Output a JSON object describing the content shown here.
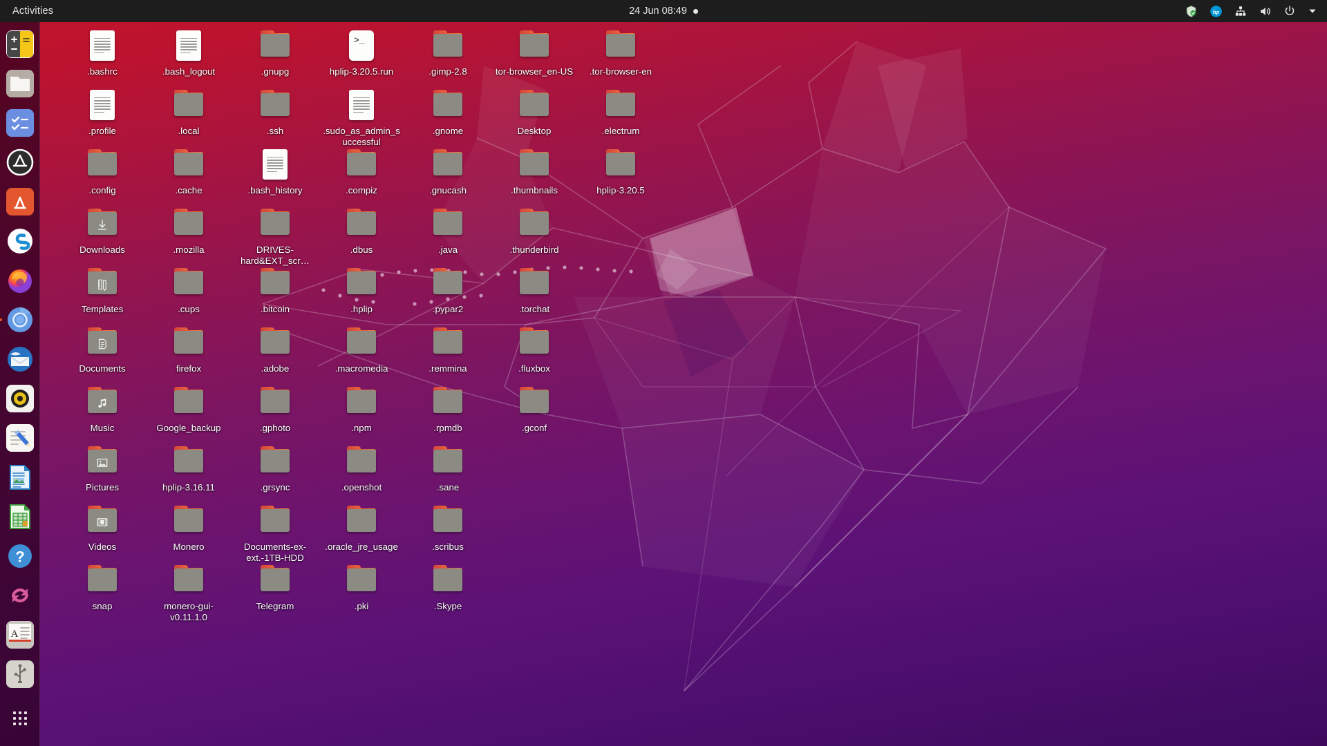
{
  "topbar": {
    "activities_label": "Activities",
    "clock": "24 Jun  08:49",
    "notification_dot": true,
    "indicators": [
      {
        "name": "shield-icon",
        "title": "Privacy Shield"
      },
      {
        "name": "hp-logo-icon",
        "title": "HP"
      },
      {
        "name": "network-icon",
        "title": "Wired Network"
      },
      {
        "name": "volume-icon",
        "title": "Volume"
      },
      {
        "name": "power-icon",
        "title": "Power"
      },
      {
        "name": "chevron-down-icon",
        "title": "System Menu"
      }
    ]
  },
  "dock": {
    "items": [
      {
        "name": "calculator",
        "label": "Calculator",
        "running": false
      },
      {
        "name": "files",
        "label": "Files",
        "running": false
      },
      {
        "name": "todo",
        "label": "To Do",
        "running": false
      },
      {
        "name": "ubuntu-software-updates",
        "label": "Software Updater",
        "running": false
      },
      {
        "name": "ubuntu-software",
        "label": "Ubuntu Software",
        "running": false
      },
      {
        "name": "skype",
        "label": "Skype",
        "running": false
      },
      {
        "name": "firefox",
        "label": "Firefox",
        "running": false
      },
      {
        "name": "chromium",
        "label": "Chromium",
        "running": true
      },
      {
        "name": "thunderbird",
        "label": "Thunderbird Mail",
        "running": false
      },
      {
        "name": "rhythmbox",
        "label": "Rhythmbox",
        "running": false
      },
      {
        "name": "text-editor",
        "label": "Text Editor",
        "running": false
      },
      {
        "name": "libreoffice-writer",
        "label": "LibreOffice Writer",
        "running": false
      },
      {
        "name": "libreoffice-calc",
        "label": "LibreOffice Calc",
        "running": false
      },
      {
        "name": "help",
        "label": "Help",
        "running": false
      },
      {
        "name": "software-updater-sync",
        "label": "Software Updater",
        "running": false
      },
      {
        "name": "dictionary",
        "label": "Dictionary",
        "running": false
      },
      {
        "name": "usb-creator",
        "label": "Startup Disk Creator",
        "running": false
      }
    ],
    "show_applications_label": "Show Applications"
  },
  "desktop": {
    "icons": [
      {
        "label": ".bashrc",
        "type": "file",
        "col": 0,
        "row": 0
      },
      {
        "label": ".bash_logout",
        "type": "file",
        "col": 1,
        "row": 0
      },
      {
        "label": ".gnupg",
        "type": "folder",
        "col": 2,
        "row": 0
      },
      {
        "label": "hplip-3.20.5.run",
        "type": "script",
        "col": 3,
        "row": 0
      },
      {
        "label": ".gimp-2.8",
        "type": "folder",
        "col": 4,
        "row": 0
      },
      {
        "label": "tor-browser_en-US",
        "type": "folder",
        "col": 5,
        "row": 0
      },
      {
        "label": ".tor-browser-en",
        "type": "folder",
        "col": 6,
        "row": 0
      },
      {
        "label": ".profile",
        "type": "file",
        "col": 0,
        "row": 1
      },
      {
        "label": ".local",
        "type": "folder",
        "col": 1,
        "row": 1
      },
      {
        "label": ".ssh",
        "type": "folder",
        "col": 2,
        "row": 1
      },
      {
        "label": ".sudo_as_admin_successful",
        "type": "file",
        "col": 3,
        "row": 1
      },
      {
        "label": ".gnome",
        "type": "folder",
        "col": 4,
        "row": 1
      },
      {
        "label": "Desktop",
        "type": "folder",
        "col": 5,
        "row": 1
      },
      {
        "label": ".electrum",
        "type": "folder",
        "col": 6,
        "row": 1
      },
      {
        "label": ".config",
        "type": "folder",
        "col": 0,
        "row": 2
      },
      {
        "label": ".cache",
        "type": "folder",
        "col": 1,
        "row": 2
      },
      {
        "label": ".bash_history",
        "type": "file",
        "col": 2,
        "row": 2
      },
      {
        "label": ".compiz",
        "type": "folder",
        "col": 3,
        "row": 2
      },
      {
        "label": ".gnucash",
        "type": "folder",
        "col": 4,
        "row": 2
      },
      {
        "label": ".thumbnails",
        "type": "folder",
        "col": 5,
        "row": 2
      },
      {
        "label": "hplip-3.20.5",
        "type": "folder",
        "col": 6,
        "row": 2
      },
      {
        "label": "Downloads",
        "type": "folder",
        "emblem": "download",
        "col": 0,
        "row": 3
      },
      {
        "label": ".mozilla",
        "type": "folder",
        "col": 1,
        "row": 3
      },
      {
        "label": "DRIVES-hard&EXT_scr…",
        "type": "folder",
        "col": 2,
        "row": 3
      },
      {
        "label": ".dbus",
        "type": "folder",
        "col": 3,
        "row": 3
      },
      {
        "label": ".java",
        "type": "folder",
        "col": 4,
        "row": 3
      },
      {
        "label": ".thunderbird",
        "type": "folder",
        "col": 5,
        "row": 3
      },
      {
        "label": "Templates",
        "type": "folder",
        "emblem": "template",
        "col": 0,
        "row": 4
      },
      {
        "label": ".cups",
        "type": "folder",
        "col": 1,
        "row": 4
      },
      {
        "label": ".bitcoin",
        "type": "folder",
        "col": 2,
        "row": 4
      },
      {
        "label": ".hplip",
        "type": "folder",
        "col": 3,
        "row": 4
      },
      {
        "label": ".pypar2",
        "type": "folder",
        "col": 4,
        "row": 4
      },
      {
        "label": ".torchat",
        "type": "folder",
        "col": 5,
        "row": 4
      },
      {
        "label": "Documents",
        "type": "folder",
        "emblem": "document",
        "col": 0,
        "row": 5
      },
      {
        "label": "firefox",
        "type": "folder",
        "col": 1,
        "row": 5
      },
      {
        "label": ".adobe",
        "type": "folder",
        "col": 2,
        "row": 5
      },
      {
        "label": ".macromedia",
        "type": "folder",
        "col": 3,
        "row": 5
      },
      {
        "label": ".remmina",
        "type": "folder",
        "col": 4,
        "row": 5
      },
      {
        "label": ".fluxbox",
        "type": "folder",
        "col": 5,
        "row": 5
      },
      {
        "label": "Music",
        "type": "folder",
        "emblem": "music",
        "col": 0,
        "row": 6
      },
      {
        "label": "Google_backup",
        "type": "folder",
        "col": 1,
        "row": 6
      },
      {
        "label": ".gphoto",
        "type": "folder",
        "col": 2,
        "row": 6
      },
      {
        "label": ".npm",
        "type": "folder",
        "col": 3,
        "row": 6
      },
      {
        "label": ".rpmdb",
        "type": "folder",
        "col": 4,
        "row": 6
      },
      {
        "label": ".gconf",
        "type": "folder",
        "col": 5,
        "row": 6
      },
      {
        "label": "Pictures",
        "type": "folder",
        "emblem": "picture",
        "col": 0,
        "row": 7
      },
      {
        "label": "hplip-3.16.11",
        "type": "folder",
        "col": 1,
        "row": 7
      },
      {
        "label": ".grsync",
        "type": "folder",
        "col": 2,
        "row": 7
      },
      {
        "label": ".openshot",
        "type": "folder",
        "col": 3,
        "row": 7
      },
      {
        "label": ".sane",
        "type": "folder",
        "col": 4,
        "row": 7
      },
      {
        "label": "Videos",
        "type": "folder",
        "emblem": "video",
        "col": 0,
        "row": 8
      },
      {
        "label": "Monero",
        "type": "folder",
        "col": 1,
        "row": 8
      },
      {
        "label": "Documents-ex-ext.-1TB-HDD",
        "type": "folder",
        "col": 2,
        "row": 8
      },
      {
        "label": ".oracle_jre_usage",
        "type": "folder",
        "col": 3,
        "row": 8
      },
      {
        "label": ".scribus",
        "type": "folder",
        "col": 4,
        "row": 8
      },
      {
        "label": "snap",
        "type": "folder",
        "col": 0,
        "row": 9
      },
      {
        "label": "monero-gui-v0.11.1.0",
        "type": "folder",
        "col": 1,
        "row": 9
      },
      {
        "label": "Telegram",
        "type": "folder",
        "col": 2,
        "row": 9
      },
      {
        "label": ".pki",
        "type": "folder",
        "col": 3,
        "row": 9
      },
      {
        "label": ".Skype",
        "type": "folder",
        "col": 4,
        "row": 9
      }
    ]
  },
  "colors": {
    "accent": "#e95420",
    "topbar_bg": "#1d1d1d",
    "dock_bg": "#2c001e",
    "wallpaper_top": "#c5132b",
    "wallpaper_bottom": "#3d0a5e",
    "folder_body": "#8b8b84",
    "label_text": "#ffffff"
  }
}
